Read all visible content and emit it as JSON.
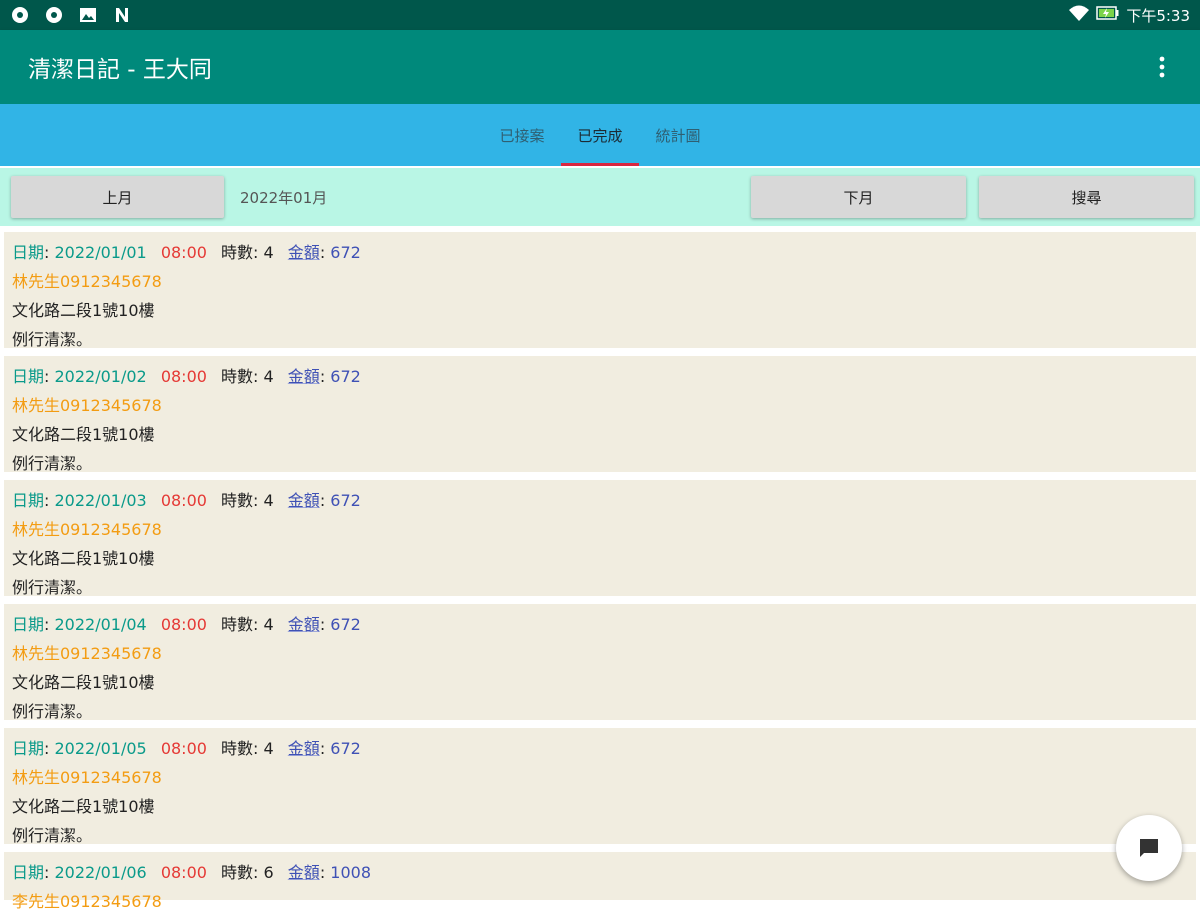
{
  "statusbar": {
    "time": "下午5:33"
  },
  "appbar": {
    "title": "清潔日記 - 王大同"
  },
  "tabs": [
    {
      "label": "已接案"
    },
    {
      "label": "已完成"
    },
    {
      "label": "統計圖"
    }
  ],
  "controls": {
    "prev_label": "上月",
    "month": "2022年01月",
    "next_label": "下月",
    "search_label": "搜尋"
  },
  "labels": {
    "date": "日期",
    "hours": "時數",
    "amount": "金額"
  },
  "records": [
    {
      "date": "2022/01/01",
      "time": "08:00",
      "hours": "4",
      "amount": "672",
      "customer": "林先生0912345678",
      "address": "文化路二段1號10樓",
      "note": "例行清潔。"
    },
    {
      "date": "2022/01/02",
      "time": "08:00",
      "hours": "4",
      "amount": "672",
      "customer": "林先生0912345678",
      "address": "文化路二段1號10樓",
      "note": "例行清潔。"
    },
    {
      "date": "2022/01/03",
      "time": "08:00",
      "hours": "4",
      "amount": "672",
      "customer": "林先生0912345678",
      "address": "文化路二段1號10樓",
      "note": "例行清潔。"
    },
    {
      "date": "2022/01/04",
      "time": "08:00",
      "hours": "4",
      "amount": "672",
      "customer": "林先生0912345678",
      "address": "文化路二段1號10樓",
      "note": "例行清潔。"
    },
    {
      "date": "2022/01/05",
      "time": "08:00",
      "hours": "4",
      "amount": "672",
      "customer": "林先生0912345678",
      "address": "文化路二段1號10樓",
      "note": "例行清潔。"
    },
    {
      "date": "2022/01/06",
      "time": "08:00",
      "hours": "6",
      "amount": "1008",
      "customer": "李先生0912345678",
      "address": "",
      "note": ""
    }
  ]
}
